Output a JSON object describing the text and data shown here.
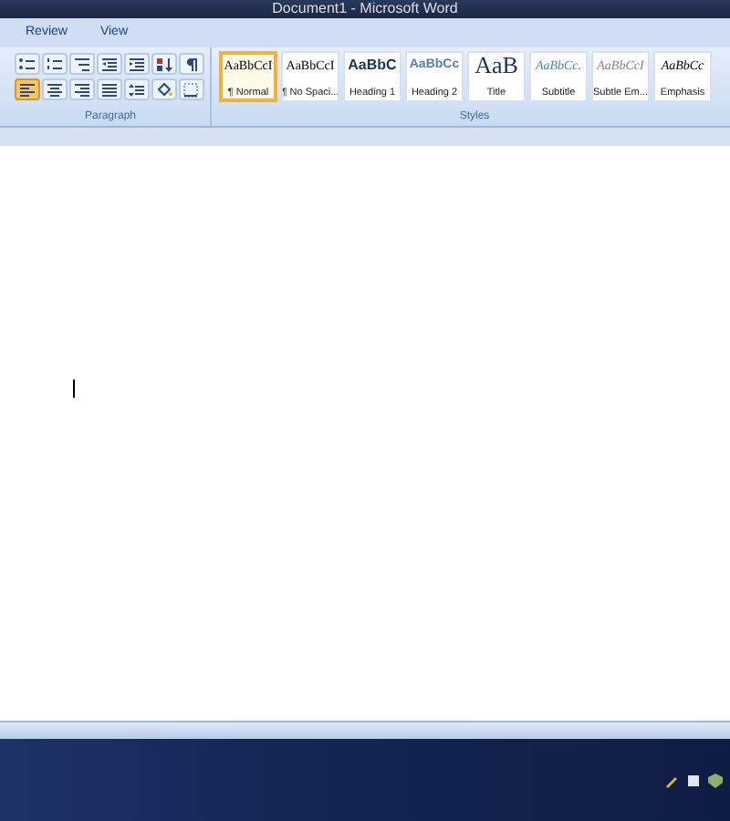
{
  "window": {
    "title": "Document1 - Microsoft Word"
  },
  "tabs": [
    {
      "label": "Review",
      "selected": false
    },
    {
      "label": "View",
      "selected": false
    }
  ],
  "paragraph": {
    "label": "Paragraph",
    "buttons": [
      {
        "kind": "bullets",
        "selected": false
      },
      {
        "kind": "numbering",
        "selected": false
      },
      {
        "kind": "multilevel",
        "selected": false
      },
      {
        "kind": "outdent",
        "selected": false
      },
      {
        "kind": "indent",
        "selected": false
      },
      {
        "kind": "sort",
        "selected": false
      },
      {
        "kind": "pilcrow",
        "selected": false
      },
      {
        "kind": "align-left",
        "selected": true
      },
      {
        "kind": "align-center",
        "selected": false
      },
      {
        "kind": "align-right",
        "selected": false
      },
      {
        "kind": "justify",
        "selected": false
      },
      {
        "kind": "line-spacing",
        "selected": false
      },
      {
        "kind": "shading",
        "selected": false
      },
      {
        "kind": "borders",
        "selected": false
      }
    ]
  },
  "styles": {
    "label": "Styles",
    "items": [
      {
        "sample": "AaBbCcI",
        "name": "¶ Normal",
        "kind": "normal",
        "selected": true
      },
      {
        "sample": "AaBbCcI",
        "name": "¶ No Spaci...",
        "kind": "normal",
        "selected": false
      },
      {
        "sample": "AaBbC",
        "name": "Heading 1",
        "kind": "heading1",
        "selected": false
      },
      {
        "sample": "AaBbCc",
        "name": "Heading 2",
        "kind": "heading2",
        "selected": false
      },
      {
        "sample": "AaB",
        "name": "Title",
        "kind": "title",
        "selected": false
      },
      {
        "sample": "AaBbCc.",
        "name": "Subtitle",
        "kind": "subtitle",
        "selected": false
      },
      {
        "sample": "AaBbCcI",
        "name": "Subtle Em...",
        "kind": "subtle",
        "selected": false
      },
      {
        "sample": "AaBbCc",
        "name": "Emphasis",
        "kind": "emphasis",
        "selected": false
      }
    ]
  }
}
